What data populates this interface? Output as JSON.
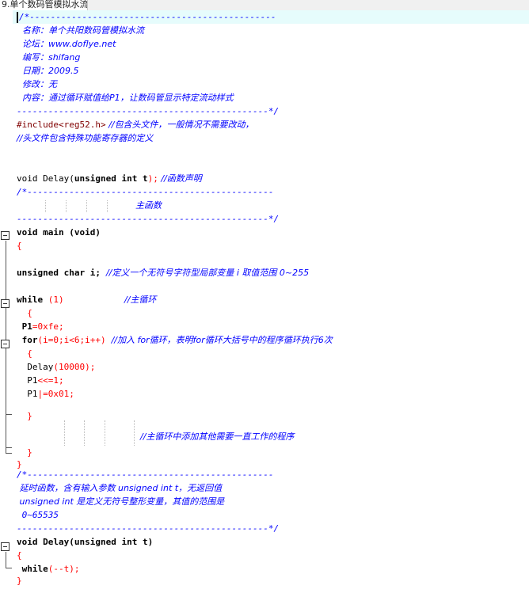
{
  "tab": {
    "title": "9.单个数码管模拟水流"
  },
  "code": {
    "header_open": "/*-----------------------------------------------",
    "header_name": "  名称：单个共阳数码管模拟水流",
    "header_forum": "  论坛：www.doflye.net",
    "header_author": "  编写：shifang",
    "header_date": "  日期：2009.5",
    "header_modify": "  修改：无",
    "header_content": "  内容：通过循环赋值给P1，让数码管显示特定流动样式",
    "header_close": "------------------------------------------------*/",
    "include_directive": "#include<reg52.h>",
    "include_comment": " //包含头文件，一般情况不需要改动，",
    "include_comment2": "//头文件包含特殊功能寄存器的定义",
    "decl_type": "void Delay(",
    "decl_params": "unsigned int t",
    "decl_end": ");",
    "decl_comment": " //函数声明",
    "main_banner_open": "/*-----------------------------------------------",
    "main_banner_title": "主函数",
    "main_banner_close": "------------------------------------------------*/",
    "main_sig_type": "void main (",
    "main_sig_params": "void",
    "main_sig_end": ")",
    "brace_open": "{",
    "var_decl": "unsigned char i;",
    "var_comment": "  //定义一个无符号字符型局部变量 i 取值范围 0~255",
    "while_kw": "while ",
    "while_cond": "(1)",
    "while_comment": "//主循环",
    "inner_brace_open": "  {",
    "p1_assign_lhs": " P1",
    "p1_assign_rhs": "=0xfe;",
    "for_kw": " for",
    "for_cond": "(i=0;i<6;i++)",
    "for_comment": "  //加入 for循环，表明for循环大括号中的程序循环执行6次",
    "for_brace_open": "  {",
    "delay_call": "  Delay",
    "delay_arg": "(10000);",
    "shift_lhs": "  P1",
    "shift_rhs": "<<=1;",
    "or_lhs": "  P1",
    "or_rhs": "|=0x01;",
    "for_brace_close": "  }",
    "loop_comment": "//主循环中添加其他需要一直工作的程序",
    "inner_brace_close": "  }",
    "brace_close": "}",
    "delay_banner_open": "/*-----------------------------------------------",
    "delay_desc1": " 延时函数，含有输入参数 unsigned int t，无返回值",
    "delay_desc2": " unsigned int 是定义无符号整形变量，其值的范围是",
    "delay_desc3": " 0~65535",
    "delay_banner_close": "------------------------------------------------*/",
    "delay_def": "void Delay(unsigned int t)",
    "delay_brace_open": "{",
    "delay_while_kw": " while",
    "delay_while_body": "(--t);",
    "delay_brace_close": "}"
  }
}
